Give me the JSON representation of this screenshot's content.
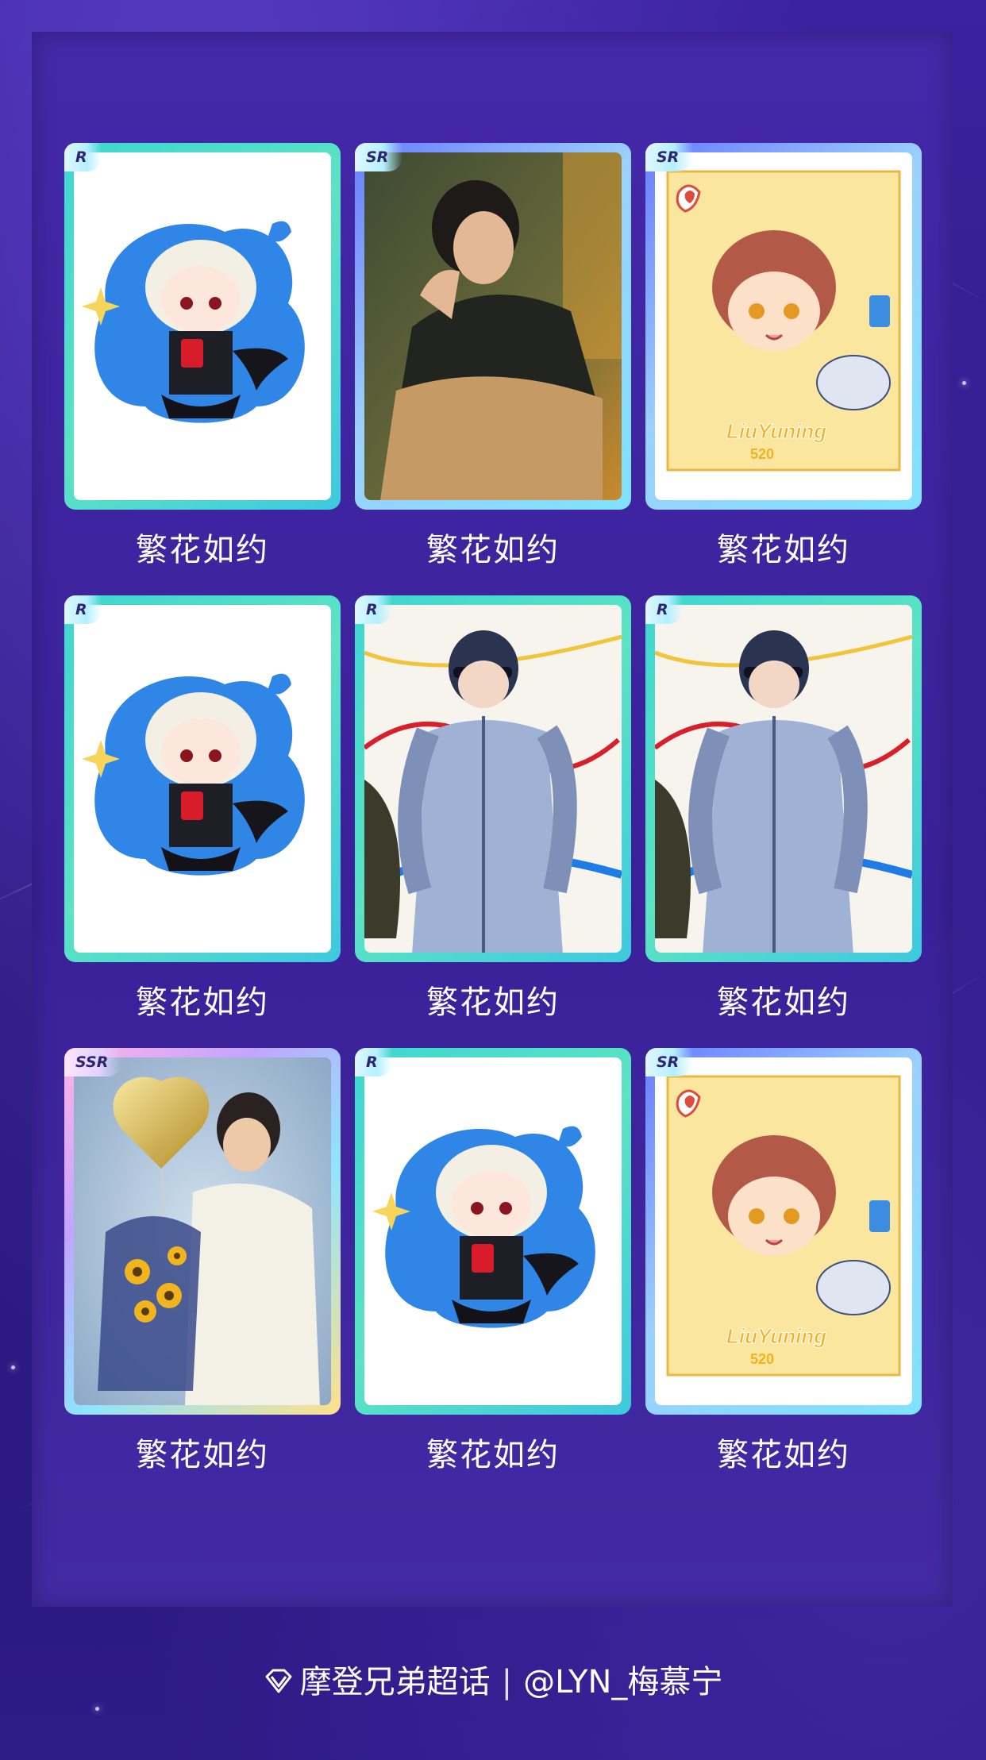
{
  "cards": [
    {
      "rarity": "R",
      "title": "繁花如约",
      "art": "chibi-blond"
    },
    {
      "rarity": "SR",
      "title": "繁花如约",
      "art": "portrait-dark"
    },
    {
      "rarity": "SR",
      "title": "繁花如约",
      "art": "chibi-frame",
      "art_caption": "LiuYuning 520"
    },
    {
      "rarity": "R",
      "title": "繁花如约",
      "art": "chibi-blond"
    },
    {
      "rarity": "R",
      "title": "繁花如约",
      "art": "stage-suit"
    },
    {
      "rarity": "R",
      "title": "繁花如约",
      "art": "stage-suit"
    },
    {
      "rarity": "SSR",
      "title": "繁花如约",
      "art": "balloon-flowers"
    },
    {
      "rarity": "R",
      "title": "繁花如约",
      "art": "chibi-blond"
    },
    {
      "rarity": "SR",
      "title": "繁花如约",
      "art": "chibi-frame",
      "art_caption": "LiuYuning 520"
    }
  ],
  "footer": {
    "icon": "diamond-icon",
    "forum": "摩登兄弟超话",
    "separator": "|",
    "user": "@LYN_梅慕宁"
  }
}
